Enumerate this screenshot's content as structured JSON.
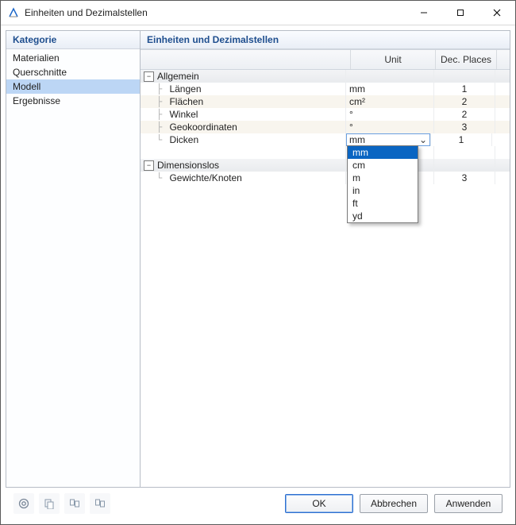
{
  "window": {
    "title": "Einheiten und Dezimalstellen"
  },
  "sidebar": {
    "title": "Kategorie",
    "items": [
      "Materialien",
      "Querschnitte",
      "Modell",
      "Ergebnisse"
    ],
    "selected_index": 2
  },
  "main": {
    "title": "Einheiten und Dezimalstellen",
    "columns": {
      "unit": "Unit",
      "dec": "Dec. Places"
    },
    "groups": [
      {
        "label": "Allgemein",
        "rows": [
          {
            "label": "Längen",
            "unit": "mm",
            "dec": "1"
          },
          {
            "label": "Flächen",
            "unit": "cm²",
            "dec": "2"
          },
          {
            "label": "Winkel",
            "unit": "°",
            "dec": "2"
          },
          {
            "label": "Geokoordinaten",
            "unit": "°",
            "dec": "3"
          },
          {
            "label": "Dicken",
            "unit": "mm",
            "dec": "1",
            "combo_open": true
          }
        ]
      },
      {
        "label": "Dimensionslos",
        "rows": [
          {
            "label": "Gewichte/Knoten",
            "unit": "",
            "dec": "3"
          }
        ]
      }
    ],
    "dropdown": {
      "options": [
        "mm",
        "cm",
        "m",
        "in",
        "ft",
        "yd"
      ],
      "selected_index": 0
    }
  },
  "footer": {
    "ok": "OK",
    "cancel": "Abbrechen",
    "apply": "Anwenden"
  }
}
